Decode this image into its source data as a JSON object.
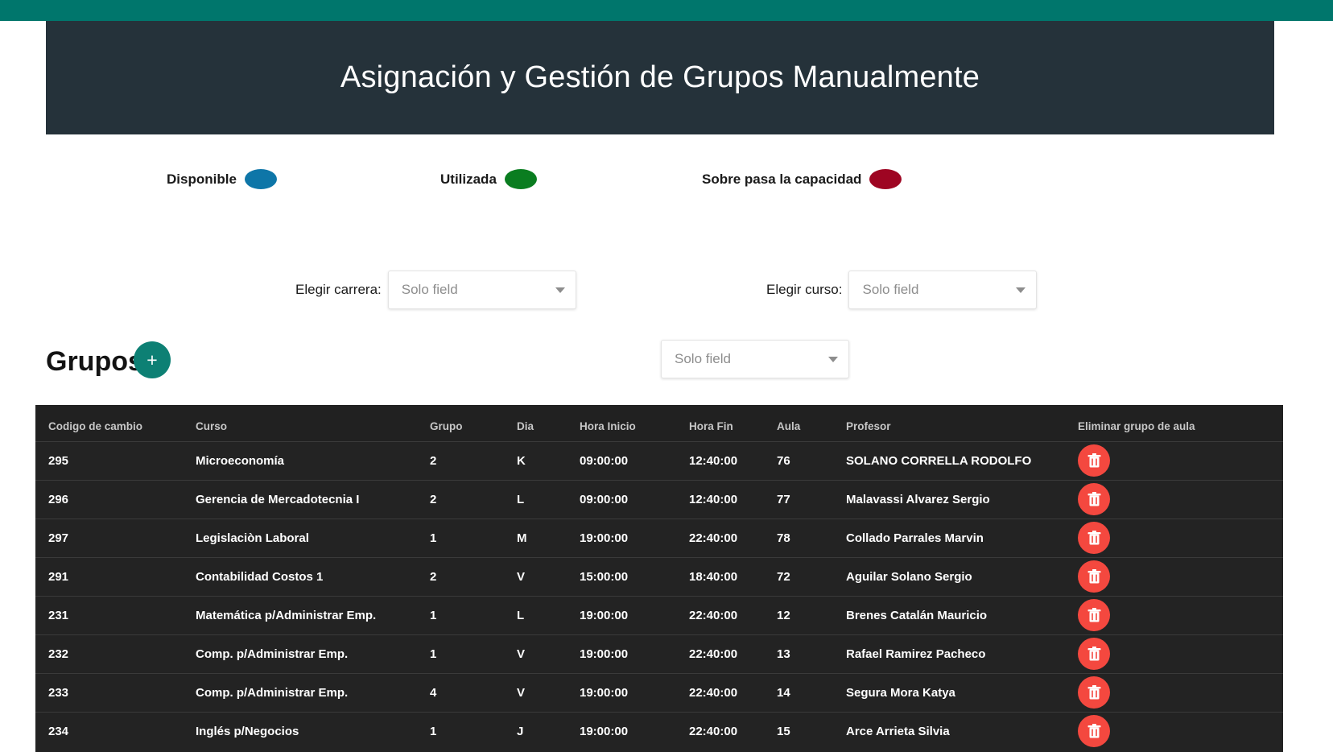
{
  "header": {
    "title": "Asignación y Gestión de Grupos Manualmente",
    "accent_color": "#00766c",
    "panel_color": "#25323a"
  },
  "legend": {
    "items": [
      {
        "label": "Disponible",
        "color": "#0e76a8"
      },
      {
        "label": "Utilizada",
        "color": "#0a7d20"
      },
      {
        "label": "Sobre pasa la capacidad",
        "color": "#9e0522"
      }
    ]
  },
  "filters": [
    {
      "label": "Elegir carrera:",
      "value": "Solo field",
      "placeholder": "Solo field"
    },
    {
      "label": "Elegir curso:",
      "value": "Solo field",
      "placeholder": "Solo field"
    }
  ],
  "groups_section": {
    "title": "Grupos",
    "add_button_label": "+",
    "add_button_color": "#0d8074",
    "select": {
      "value": "Solo field",
      "placeholder": "Solo field"
    }
  },
  "table": {
    "columns": [
      "Codigo de cambio",
      "Curso",
      "Grupo",
      "Dia",
      "Hora Inicio",
      "Hora Fin",
      "Aula",
      "Profesor",
      "Eliminar grupo de aula"
    ],
    "delete_button_color": "#f4483f",
    "rows": [
      {
        "codigo": "295",
        "curso": "Microeconomía",
        "grupo": "2",
        "dia": "K",
        "hora_inicio": "09:00:00",
        "hora_fin": "12:40:00",
        "aula": "76",
        "profesor": "SOLANO CORRELLA RODOLFO"
      },
      {
        "codigo": "296",
        "curso": "Gerencia de Mercadotecnia I",
        "grupo": "2",
        "dia": "L",
        "hora_inicio": "09:00:00",
        "hora_fin": "12:40:00",
        "aula": "77",
        "profesor": "Malavassi Alvarez Sergio"
      },
      {
        "codigo": "297",
        "curso": "Legislaciòn Laboral",
        "grupo": "1",
        "dia": "M",
        "hora_inicio": "19:00:00",
        "hora_fin": "22:40:00",
        "aula": "78",
        "profesor": "Collado Parrales Marvin"
      },
      {
        "codigo": "291",
        "curso": "Contabilidad Costos 1",
        "grupo": "2",
        "dia": "V",
        "hora_inicio": "15:00:00",
        "hora_fin": "18:40:00",
        "aula": "72",
        "profesor": "Aguilar Solano Sergio"
      },
      {
        "codigo": "231",
        "curso": "Matemática p/Administrar Emp.",
        "grupo": "1",
        "dia": "L",
        "hora_inicio": "19:00:00",
        "hora_fin": "22:40:00",
        "aula": "12",
        "profesor": "Brenes Catalán Mauricio"
      },
      {
        "codigo": "232",
        "curso": "Comp. p/Administrar Emp.",
        "grupo": "1",
        "dia": "V",
        "hora_inicio": "19:00:00",
        "hora_fin": "22:40:00",
        "aula": "13",
        "profesor": "Rafael Ramirez Pacheco"
      },
      {
        "codigo": "233",
        "curso": "Comp. p/Administrar Emp.",
        "grupo": "4",
        "dia": "V",
        "hora_inicio": "19:00:00",
        "hora_fin": "22:40:00",
        "aula": "14",
        "profesor": "Segura Mora Katya"
      },
      {
        "codigo": "234",
        "curso": "Inglés p/Negocios",
        "grupo": "1",
        "dia": "J",
        "hora_inicio": "19:00:00",
        "hora_fin": "22:40:00",
        "aula": "15",
        "profesor": "Arce Arrieta Silvia"
      }
    ]
  }
}
